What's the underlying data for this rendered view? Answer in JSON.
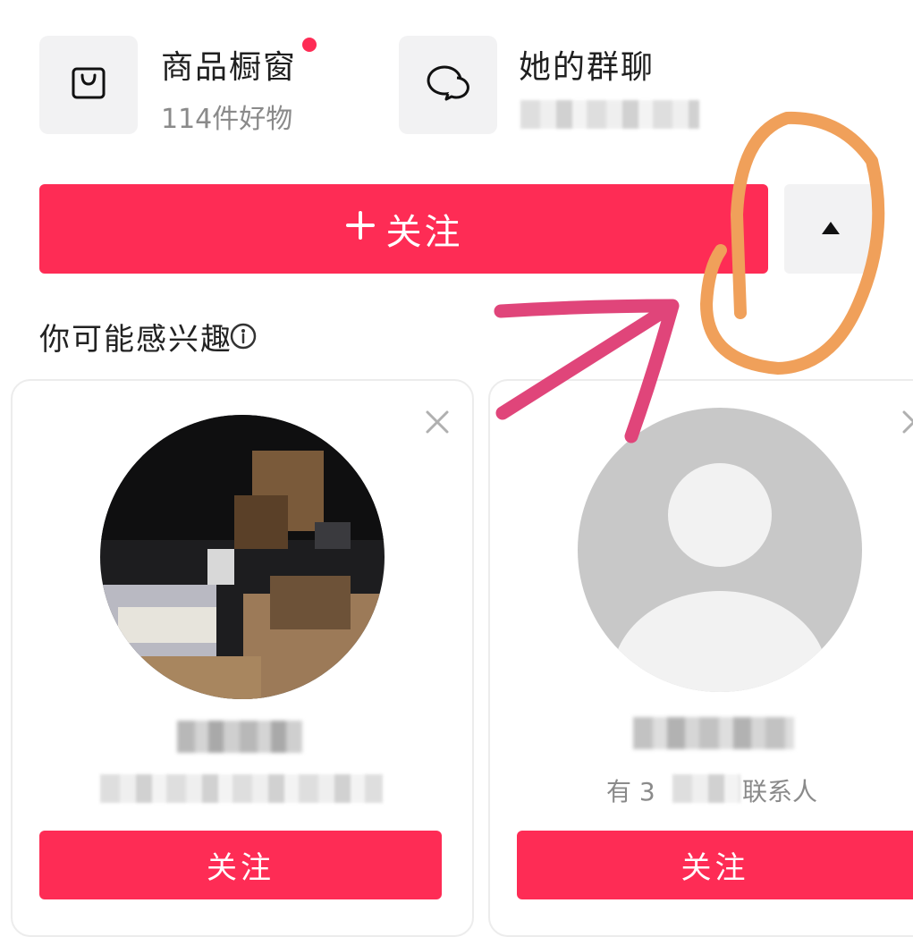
{
  "shop": {
    "title": "商品橱窗",
    "subtitle": "114件好物",
    "icon": "shopping-bag-icon"
  },
  "group_chat": {
    "title": "她的群聊",
    "icon": "chat-bubbles-icon"
  },
  "follow_button": {
    "label": "关注",
    "icon": "plus-icon"
  },
  "more_button": {
    "icon": "caret-up-icon"
  },
  "suggestions": {
    "title": "你可能感兴趣",
    "cards": [
      {
        "follow_label": "关注"
      },
      {
        "subtitle_visible_part": "有 3",
        "subtitle_tail": "联系人",
        "follow_label": "关注"
      }
    ]
  },
  "colors": {
    "accent": "#fe2c55",
    "annotation_orange": "#f0a05a",
    "annotation_pink": "#e0457a"
  }
}
